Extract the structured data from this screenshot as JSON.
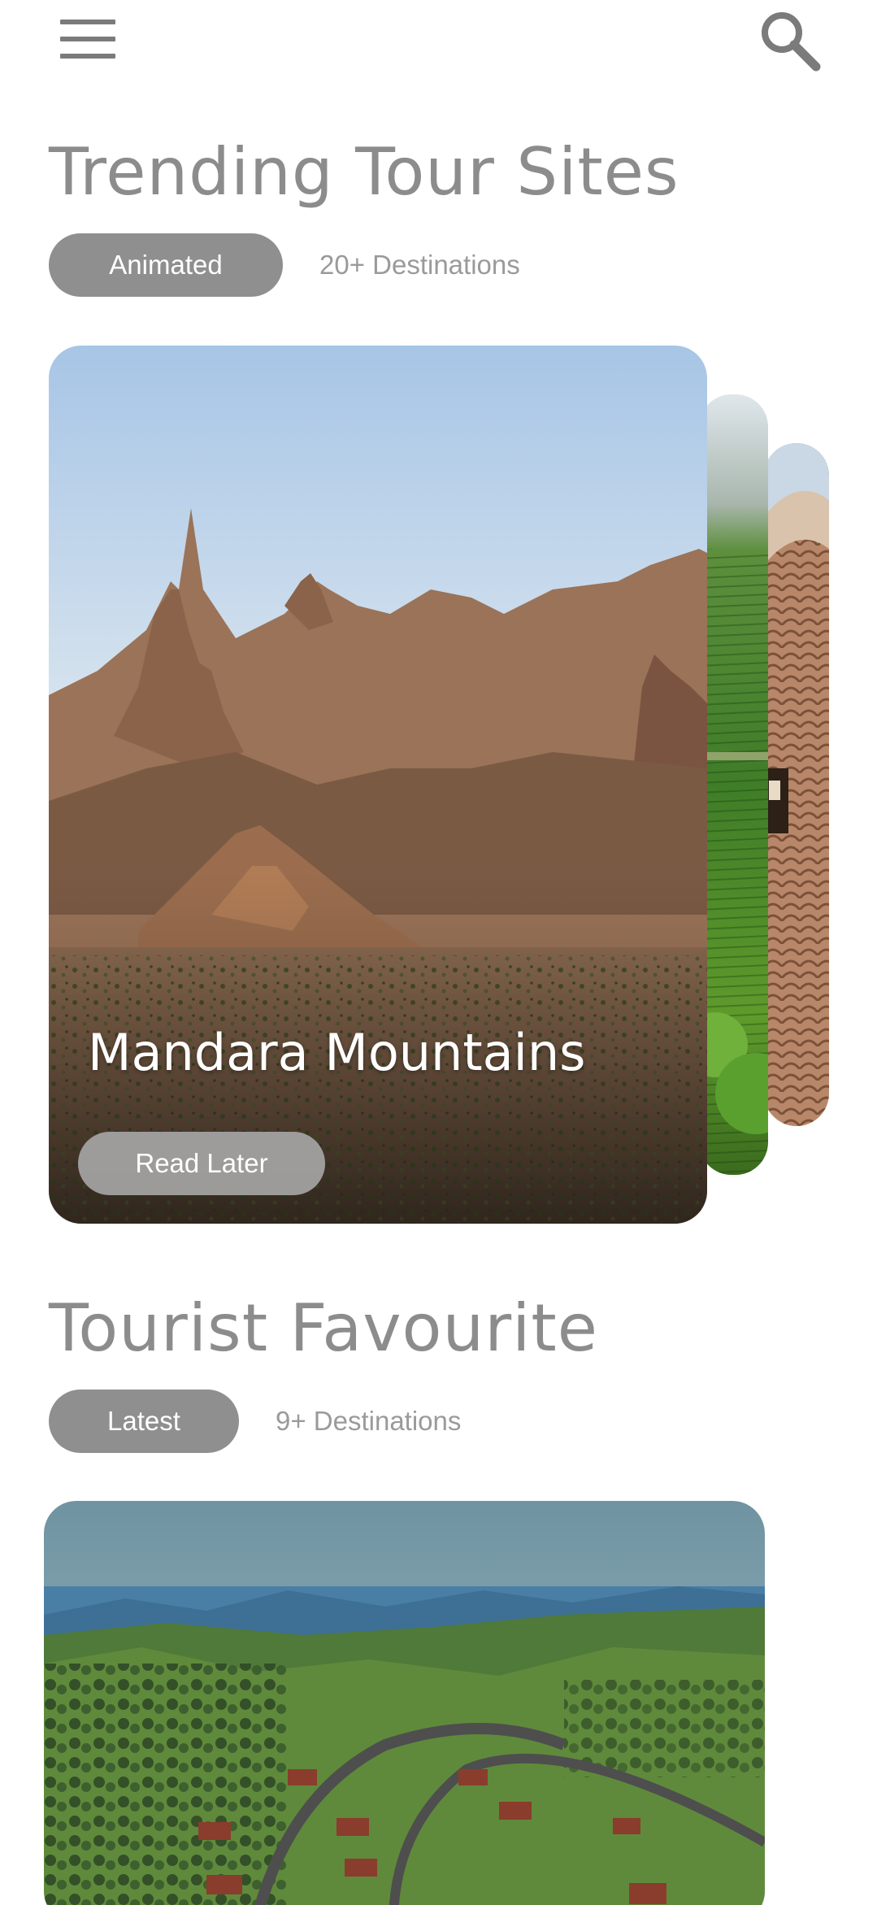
{
  "header": {
    "menu_icon": "hamburger-menu-icon",
    "search_icon": "search-icon"
  },
  "trending": {
    "title": "Trending Tour Sites",
    "chip_label": "Animated",
    "destinations": "20+ Destinations",
    "card": {
      "title": "Mandara Mountains",
      "read_later_label": "Read Later"
    }
  },
  "favourite": {
    "title": "Tourist Favourite",
    "chip_label": "Latest",
    "destinations": "9+ Destinations"
  },
  "colors": {
    "text_gray": "#8c8c8c",
    "chip_bg": "#8f8f8f",
    "muted_text": "#9a9a9a",
    "background": "#ffffff"
  }
}
